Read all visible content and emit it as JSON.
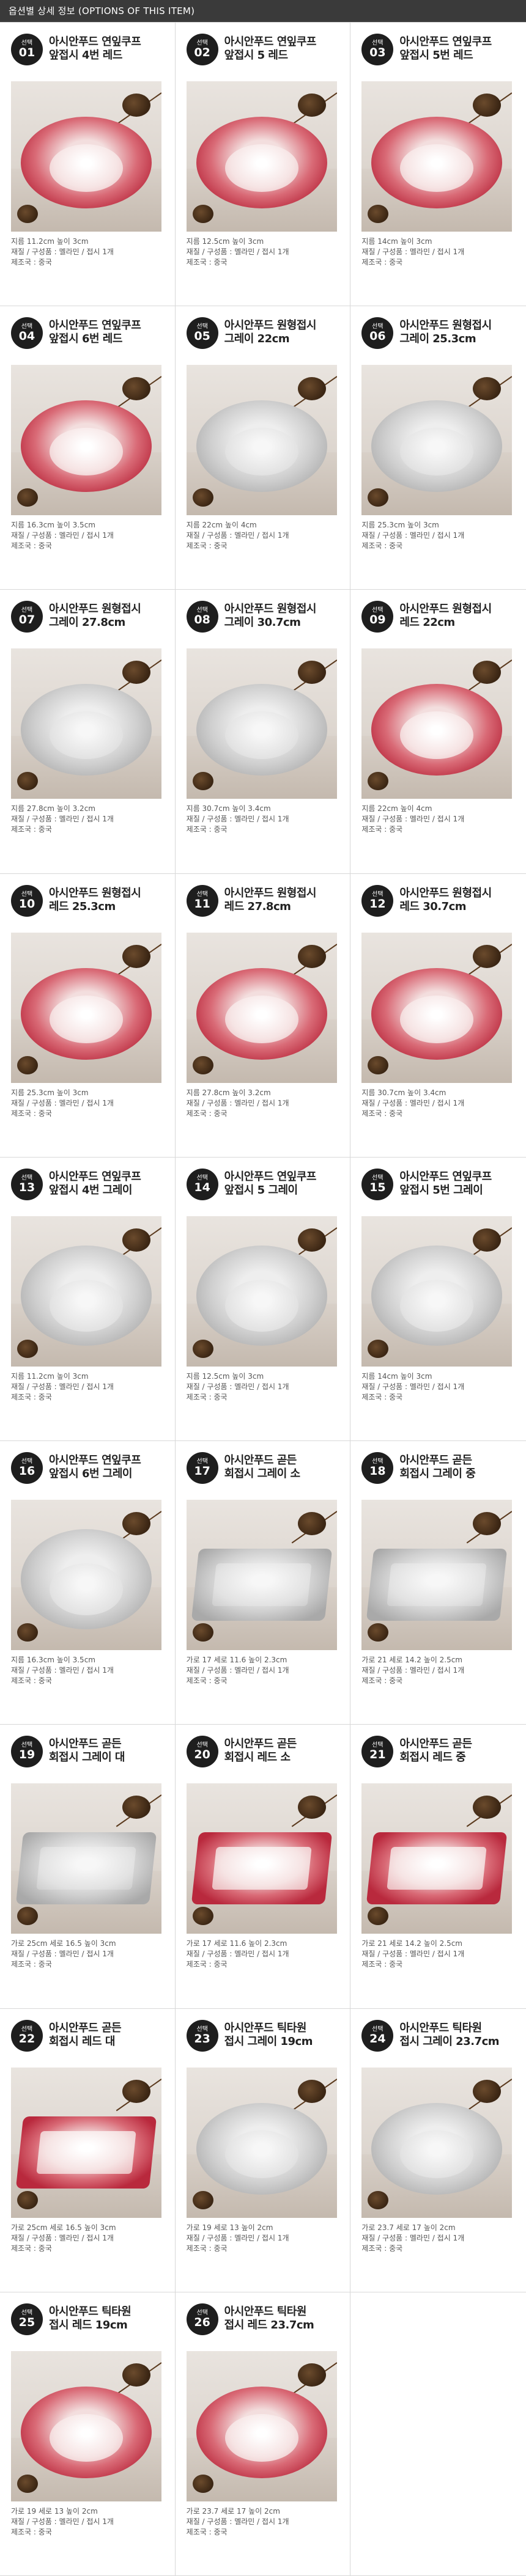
{
  "header": {
    "title": "옵션별 상세 정보 (OPTIONS OF THIS ITEM)"
  },
  "badge_label": "선택",
  "items": [
    {
      "num": "01",
      "title_1": "아시안푸드 연잎쿠프",
      "title_2": "앞접시 4번 레드",
      "size": "지름 11.2cm 높이 3cm",
      "composition": "재질 / 구성품 : 멜라민 / 접시 1개",
      "origin": "제조국 : 중국",
      "color": "red",
      "shape": "round"
    },
    {
      "num": "02",
      "title_1": "아시안푸드 연잎쿠프",
      "title_2": "앞접시 5 레드",
      "size": "지름 12.5cm 높이 3cm",
      "composition": "재질 / 구성품 : 멜라민 / 접시 1개",
      "origin": "제조국 : 중국",
      "color": "red",
      "shape": "round"
    },
    {
      "num": "03",
      "title_1": "아시안푸드 연잎쿠프",
      "title_2": "앞접시 5번 레드",
      "size": "지름 14cm 높이 3cm",
      "composition": "재질 / 구성품 : 멜라민 / 접시 1개",
      "origin": "제조국 : 중국",
      "color": "red",
      "shape": "round"
    },
    {
      "num": "04",
      "title_1": "아시안푸드 연잎쿠프",
      "title_2": "앞접시 6번 레드",
      "size": "지름 16.3cm 높이 3.5cm",
      "composition": "재질 / 구성품 : 멜라민 / 접시 1개",
      "origin": "제조국 : 중국",
      "color": "red",
      "shape": "round"
    },
    {
      "num": "05",
      "title_1": "아시안푸드 원형접시",
      "title_2": "그레이 22cm",
      "size": "지름 22cm 높이 4cm",
      "composition": "재질 / 구성품 : 멜라민 / 접시 1개",
      "origin": "제조국 : 중국",
      "color": "gray",
      "shape": "round"
    },
    {
      "num": "06",
      "title_1": "아시안푸드 원형접시",
      "title_2": "그레이 25.3cm",
      "size": "지름 25.3cm 높이 3cm",
      "composition": "재질 / 구성품 : 멜라민 / 접시 1개",
      "origin": "제조국 : 중국",
      "color": "gray",
      "shape": "round"
    },
    {
      "num": "07",
      "title_1": "아시안푸드 원형접시",
      "title_2": "그레이 27.8cm",
      "size": "지름 27.8cm 높이 3.2cm",
      "composition": "재질 / 구성품 : 멜라민 / 접시 1개",
      "origin": "제조국 : 중국",
      "color": "gray",
      "shape": "round"
    },
    {
      "num": "08",
      "title_1": "아시안푸드 원형접시",
      "title_2": "그레이 30.7cm",
      "size": "지름 30.7cm 높이 3.4cm",
      "composition": "재질 / 구성품 : 멜라민 / 접시 1개",
      "origin": "제조국 : 중국",
      "color": "gray",
      "shape": "round"
    },
    {
      "num": "09",
      "title_1": "아시안푸드 원형접시",
      "title_2": "레드 22cm",
      "size": "지름 22cm 높이 4cm",
      "composition": "재질 / 구성품 : 멜라민 / 접시 1개",
      "origin": "제조국 : 중국",
      "color": "red",
      "shape": "round"
    },
    {
      "num": "10",
      "title_1": "아시안푸드 원형접시",
      "title_2": "레드 25.3cm",
      "size": "지름 25.3cm 높이 3cm",
      "composition": "재질 / 구성품 : 멜라민 / 접시 1개",
      "origin": "제조국 : 중국",
      "color": "red",
      "shape": "round"
    },
    {
      "num": "11",
      "title_1": "아시안푸드 원형접시",
      "title_2": "레드 27.8cm",
      "size": "지름 27.8cm 높이 3.2cm",
      "composition": "재질 / 구성품 : 멜라민 / 접시 1개",
      "origin": "제조국 : 중국",
      "color": "red",
      "shape": "round"
    },
    {
      "num": "12",
      "title_1": "아시안푸드 원형접시",
      "title_2": "레드 30.7cm",
      "size": "지름 30.7cm 높이 3.4cm",
      "composition": "재질 / 구성품 : 멜라민 / 접시 1개",
      "origin": "제조국 : 중국",
      "color": "red",
      "shape": "round"
    },
    {
      "num": "13",
      "title_1": "아시안푸드 연잎쿠프",
      "title_2": "앞접시 4번 그레이",
      "size": "지름 11.2cm 높이 3cm",
      "composition": "재질 / 구성품 : 멜라민 / 접시 1개",
      "origin": "제조국 : 중국",
      "color": "gray",
      "shape": "deep"
    },
    {
      "num": "14",
      "title_1": "아시안푸드 연잎쿠프",
      "title_2": "앞접시 5 그레이",
      "size": "지름 12.5cm 높이 3cm",
      "composition": "재질 / 구성품 : 멜라민 / 접시 1개",
      "origin": "제조국 : 중국",
      "color": "gray",
      "shape": "deep"
    },
    {
      "num": "15",
      "title_1": "아시안푸드 연잎쿠프",
      "title_2": "앞접시 5번 그레이",
      "size": "지름 14cm 높이 3cm",
      "composition": "재질 / 구성품 : 멜라민 / 접시 1개",
      "origin": "제조국 : 중국",
      "color": "gray",
      "shape": "deep"
    },
    {
      "num": "16",
      "title_1": "아시안푸드 연잎쿠프",
      "title_2": "앞접시 6번 그레이",
      "size": "지름 16.3cm 높이 3.5cm",
      "composition": "재질 / 구성품 : 멜라민 / 접시 1개",
      "origin": "제조국 : 중국",
      "color": "gray",
      "shape": "deep"
    },
    {
      "num": "17",
      "title_1": "아시안푸드 곧든",
      "title_2": "회접시 그레이 소",
      "size": "가로 17 세로 11.6 높이 2.3cm",
      "composition": "재질 / 구성품 : 멜라민 / 접시 1개",
      "origin": "제조국 : 중국",
      "color": "gray",
      "shape": "rect"
    },
    {
      "num": "18",
      "title_1": "아시안푸드 곧든",
      "title_2": "회접시 그레이 중",
      "size": "가로 21 세로 14.2 높이 2.5cm",
      "composition": "재질 / 구성품 : 멜라민 / 접시 1개",
      "origin": "제조국 : 중국",
      "color": "gray",
      "shape": "rect"
    },
    {
      "num": "19",
      "title_1": "아시안푸드 곧든",
      "title_2": "회접시 그레이 대",
      "size": "가로 25cm 세로 16.5 높이 3cm",
      "composition": "재질 / 구성품 : 멜라민 / 접시 1개",
      "origin": "제조국 : 중국",
      "color": "gray",
      "shape": "rect"
    },
    {
      "num": "20",
      "title_1": "아시안푸드 곧든",
      "title_2": "회접시 레드 소",
      "size": "가로 17 세로 11.6 높이 2.3cm",
      "composition": "재질 / 구성품 : 멜라민 / 접시 1개",
      "origin": "제조국 : 중국",
      "color": "red",
      "shape": "rect"
    },
    {
      "num": "21",
      "title_1": "아시안푸드 곧든",
      "title_2": "회접시 레드 중",
      "size": "가로 21 세로 14.2 높이 2.5cm",
      "composition": "재질 / 구성품 : 멜라민 / 접시 1개",
      "origin": "제조국 : 중국",
      "color": "red",
      "shape": "rect"
    },
    {
      "num": "22",
      "title_1": "아시안푸드 곧든",
      "title_2": "회접시 레드 대",
      "size": "가로 25cm 세로 16.5 높이 3cm",
      "composition": "재질 / 구성품 : 멜라민 / 접시 1개",
      "origin": "제조국 : 중국",
      "color": "red",
      "shape": "rect"
    },
    {
      "num": "23",
      "title_1": "아시안푸드 틱타원",
      "title_2": "접시 그레이 19cm",
      "size": "가로 19 세로 13 높이 2cm",
      "composition": "재질 / 구성품 : 멜라민 / 접시 1개",
      "origin": "제조국 : 중국",
      "color": "gray",
      "shape": "round"
    },
    {
      "num": "24",
      "title_1": "아시안푸드 틱타원",
      "title_2": "접시 그레이 23.7cm",
      "size": "가로 23.7 세로 17 높이 2cm",
      "composition": "재질 / 구성품 : 멜라민 / 접시 1개",
      "origin": "제조국 : 중국",
      "color": "gray",
      "shape": "round"
    },
    {
      "num": "25",
      "title_1": "아시안푸드 틱타원",
      "title_2": "접시 레드 19cm",
      "size": "가로 19 세로 13 높이 2cm",
      "composition": "재질 / 구성품 : 멜라민 / 접시 1개",
      "origin": "제조국 : 중국",
      "color": "red",
      "shape": "round"
    },
    {
      "num": "26",
      "title_1": "아시안푸드 틱타원",
      "title_2": "접시 레드 23.7cm",
      "size": "가로 23.7 세로 17 높이 2cm",
      "composition": "재질 / 구성품 : 멜라민 / 접시 1개",
      "origin": "제조국 : 중국",
      "color": "red",
      "shape": "round"
    }
  ],
  "colors": {
    "header_bg": "#3a3a3a",
    "badge_bg": "#1e1e1e",
    "red_rim": "#b9293d",
    "gray_rim": "#a9a9a9"
  }
}
